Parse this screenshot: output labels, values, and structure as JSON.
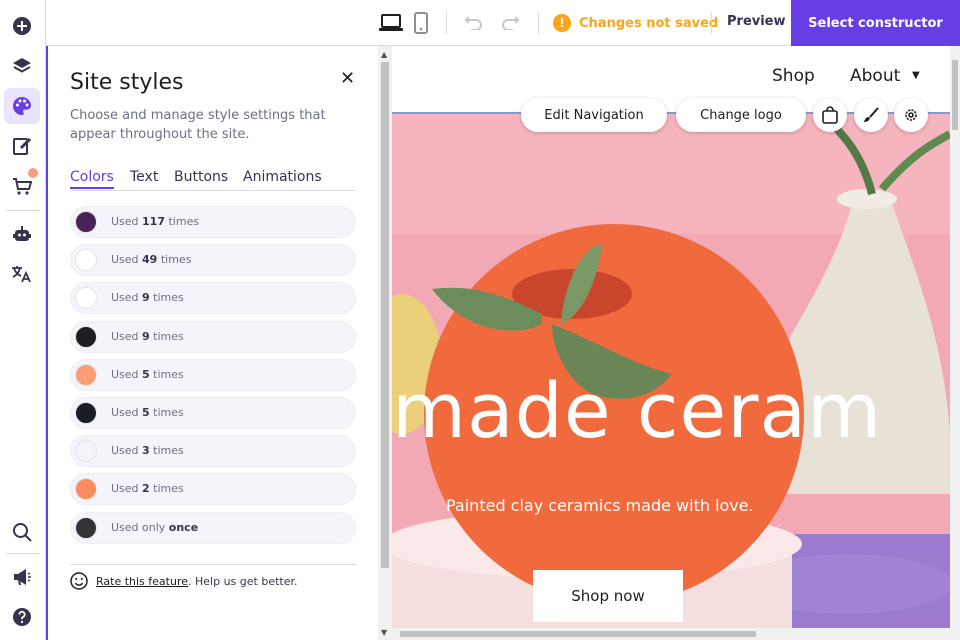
{
  "topbar": {
    "warning": "Changes not saved",
    "warning_icon": "!",
    "preview": "Preview",
    "select_constructor": "Select constructor"
  },
  "panel": {
    "title": "Site styles",
    "close": "✕",
    "description": "Choose and manage style settings that appear throughout the site.",
    "tabs": [
      "Colors",
      "Text",
      "Buttons",
      "Animations"
    ],
    "active_tab": "Colors",
    "colors": [
      {
        "swatch": "#4a2356",
        "prefix": "Used ",
        "count": "117",
        "suffix": " times"
      },
      {
        "swatch": "#ffffff",
        "prefix": "Used ",
        "count": "49",
        "suffix": " times"
      },
      {
        "swatch": "#ffffff",
        "prefix": "Used ",
        "count": "9",
        "suffix": " times"
      },
      {
        "swatch": "#1d1e20",
        "prefix": "Used ",
        "count": "9",
        "suffix": " times"
      },
      {
        "swatch": "#f89f78",
        "prefix": "Used ",
        "count": "5",
        "suffix": " times"
      },
      {
        "swatch": "#1b1d24",
        "prefix": "Used ",
        "count": "5",
        "suffix": " times"
      },
      {
        "swatch": "#f4f5fb",
        "prefix": "Used ",
        "count": "3",
        "suffix": " times"
      },
      {
        "swatch": "#fb8b60",
        "prefix": "Used ",
        "count": "2",
        "suffix": " times"
      },
      {
        "swatch": "#333333",
        "prefix": "Used only ",
        "count": "once",
        "suffix": ""
      }
    ],
    "feedback_link": "Rate this feature",
    "feedback_text": ". Help us get better."
  },
  "site": {
    "nav": {
      "shop": "Shop",
      "about": "About",
      "caret": "▼"
    },
    "edit_navigation": "Edit Navigation",
    "change_logo": "Change logo",
    "hero_title": "made ceram",
    "hero_subtitle": "Painted clay ceramics made with love.",
    "hero_button": "Shop now"
  },
  "colors": {
    "accent": "#673de6",
    "warning": "#fea419",
    "badge": "#f89f80"
  }
}
